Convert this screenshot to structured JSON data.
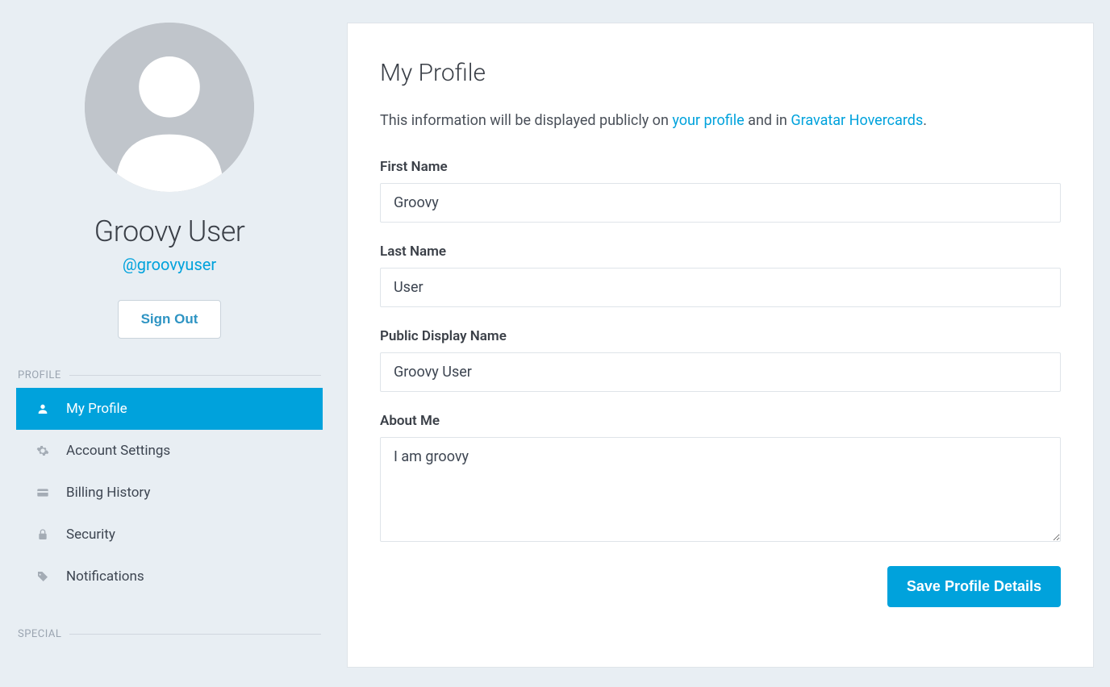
{
  "sidebar": {
    "display_name": "Groovy User",
    "handle": "@groovyuser",
    "signout_label": "Sign Out",
    "section_profile": "PROFILE",
    "section_special": "SPECIAL",
    "items": [
      {
        "label": "My Profile"
      },
      {
        "label": "Account Settings"
      },
      {
        "label": "Billing History"
      },
      {
        "label": "Security"
      },
      {
        "label": "Notifications"
      }
    ]
  },
  "main": {
    "title": "My Profile",
    "subtitle_pre": "This information will be displayed publicly on ",
    "subtitle_link1": "your profile",
    "subtitle_mid": " and in ",
    "subtitle_link2": "Gravatar Hovercards",
    "subtitle_post": ".",
    "fields": {
      "first_name": {
        "label": "First Name",
        "value": "Groovy"
      },
      "last_name": {
        "label": "Last Name",
        "value": "User"
      },
      "public_display_name": {
        "label": "Public Display Name",
        "value": "Groovy User"
      },
      "about_me": {
        "label": "About Me",
        "value": "I am groovy"
      }
    },
    "save_label": "Save Profile Details"
  },
  "colors": {
    "accent": "#00a2dc",
    "bg": "#e8eef3"
  }
}
